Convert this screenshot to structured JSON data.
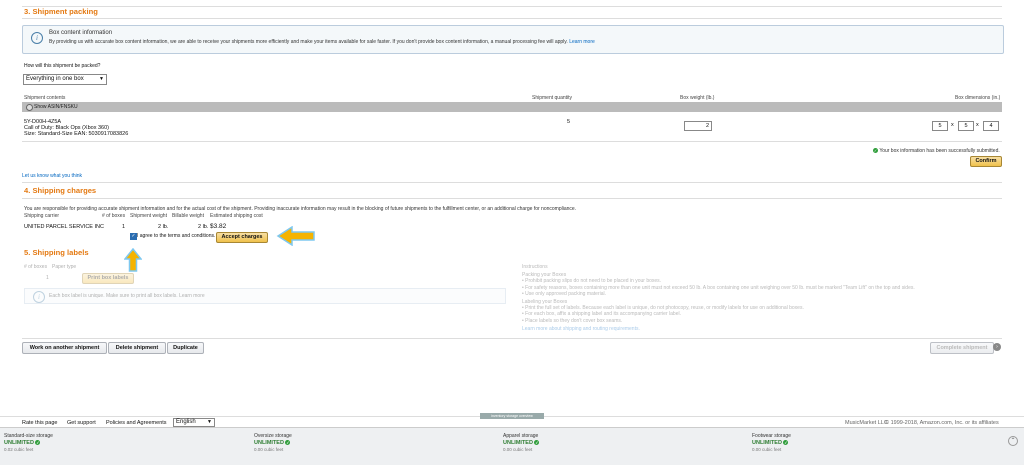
{
  "sections": {
    "packing": {
      "title": "3. Shipment packing",
      "info_title": "Box content information",
      "info_text": "By providing us with accurate box content information, we are able to receive your shipments more efficiently and make your items available for sale faster. If you don't provide box content information, a manual processing fee will apply.",
      "info_link": "Learn more",
      "question": "How will this shipment be packed?",
      "pack_option": "Everything in one box",
      "col_contents": "Shipment contents",
      "col_quantity": "Shipment quantity",
      "col_weight": "Box weight (lb.)",
      "col_dimensions": "Box dimensions (in.)",
      "show_asin": "Show ASIN/FNSKU",
      "item_sku": "5Y-D00H-4Z5A",
      "item_title": "Call of Duty: Black Ops (Xbox 360)",
      "item_size": "Size: Standard-Size EAN: 5030917083826",
      "item_quantity": "5",
      "box_weight": "2",
      "dim_l": "5",
      "dim_w": "5",
      "dim_h": "4",
      "dim_sep": "x",
      "success_msg": "Your box information has been successfully submitted.",
      "confirm": "Confirm",
      "feedback": "Let us know what you think"
    },
    "charges": {
      "title": "4. Shipping charges",
      "notice": "You are responsible for providing accurate shipment information and for the actual cost of the shipment. Providing inaccurate information may result in the blocking of future shipments to the fulfillment center, or an additional charge for noncompliance.",
      "col_carrier": "Shipping carrier",
      "col_boxes": "# of boxes",
      "col_weight": "Shipment weight",
      "col_billable": "Billable weight",
      "col_cost": "Estimated shipping cost",
      "carrier": "UNITED PARCEL SERVICE INC",
      "boxes": "1",
      "weight": "2 lb.",
      "billable": "2 lb.",
      "cost": "$3.82",
      "agree": "I agree to the terms and conditions.",
      "accept": "Accept charges"
    },
    "labels": {
      "title": "5. Shipping labels",
      "col_boxes": "# of boxes",
      "col_paper": "Paper type",
      "boxes": "1",
      "print": "Print box labels",
      "unique_note": "Each box label is unique. Make sure to print all box labels. Learn more",
      "instructions_title": "Instructions",
      "packing_title": "Packing your Boxes",
      "packing_1": "Prohibit packing slips do not need to be placed in your boxes.",
      "packing_2": "For safety reasons, boxes containing more than one unit must not exceed 50 lb. A box containing one unit weighing over 50 lb. must be marked \"Team Lift\" on the top and sides.",
      "packing_3": "Use only approved packing material.",
      "labeling_title": "Labeling your Boxes",
      "labeling_1": "Print the full set of labels. Because each label is unique, do not photocopy, reuse, or modify labels for use on additional boxes.",
      "labeling_2": "For each box, affix a shipping label and its accompanying carrier label.",
      "labeling_3": "Place labels so they don't cover box seams.",
      "learn_more": "Learn more about shipping and routing requirements."
    }
  },
  "actions": {
    "work_another": "Work on another shipment",
    "delete": "Delete shipment",
    "duplicate": "Duplicate",
    "complete": "Complete shipment"
  },
  "footer": {
    "rate": "Rate this page",
    "support": "Get support",
    "policies": "Policies and Agreements",
    "language": "English",
    "center_tab": "inventory storage overview",
    "copyright_brand": "MusicMarket LLC",
    "copyright": "© 1999-2018, Amazon.com, Inc. or its affiliates"
  },
  "storage": [
    {
      "label": "Standard-size storage",
      "value": "UNLIMITED",
      "sub": "0.02 cubic feet"
    },
    {
      "label": "Oversize storage",
      "value": "UNLIMITED",
      "sub": "0.00 cubic feet"
    },
    {
      "label": "Apparel storage",
      "value": "UNLIMITED",
      "sub": "0.00 cubic feet"
    },
    {
      "label": "Footwear storage",
      "value": "UNLIMITED",
      "sub": "0.00 cubic feet"
    }
  ],
  "colors": {
    "section_title": "#e47911",
    "accent_arrow": "#f5b300",
    "arrow_outline": "#7ec8f0",
    "link": "#0066c0"
  }
}
